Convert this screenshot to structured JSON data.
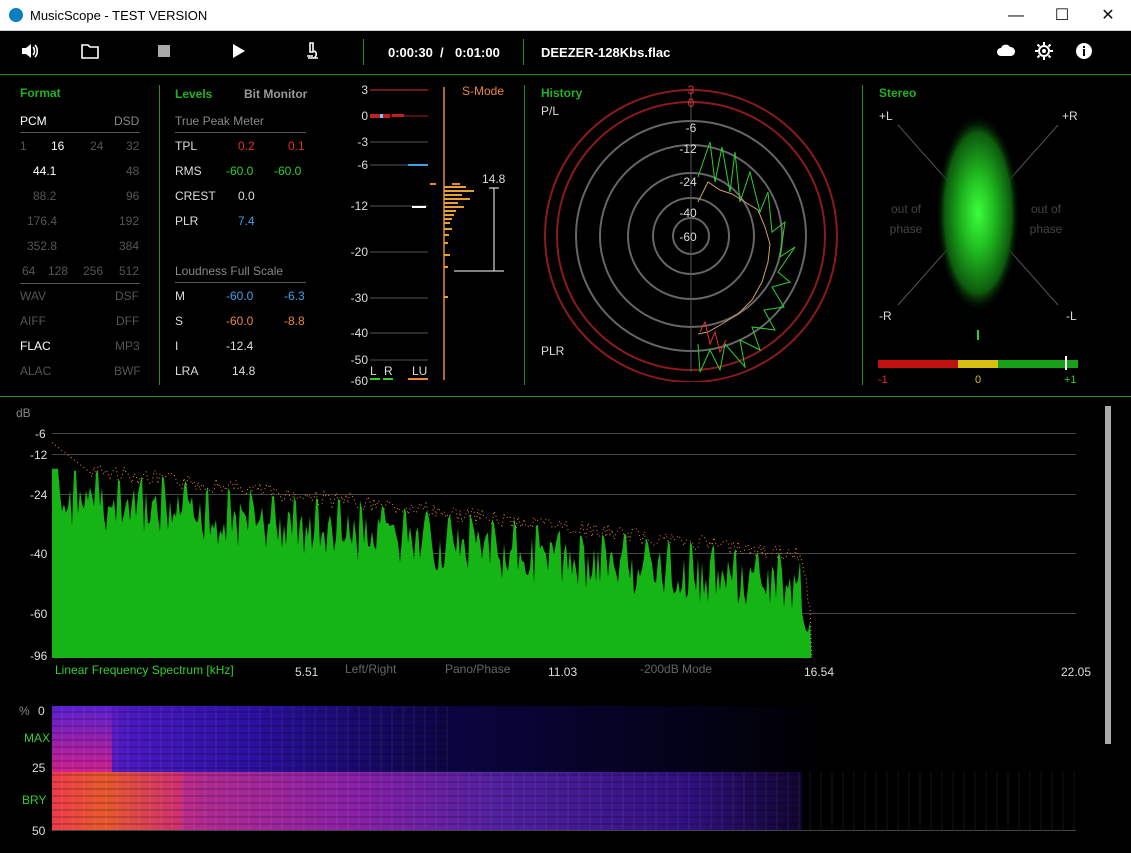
{
  "window": {
    "title": "MusicScope - TEST VERSION",
    "minimize": "—",
    "maximize": "☐",
    "close": "✕"
  },
  "toolbar": {
    "time_current": "0:00:30",
    "time_sep": "/",
    "time_total": "0:01:00",
    "filename": "DEEZER-128Kbs.flac",
    "icons": [
      "speaker-icon",
      "folder-icon",
      "stop-icon",
      "play-icon",
      "microscope-icon",
      "cloud-icon",
      "gear-icon",
      "info-icon"
    ]
  },
  "format": {
    "title": "Format",
    "pcm": "PCM",
    "dsd": "DSD",
    "bits": [
      "1",
      "16",
      "24",
      "32"
    ],
    "rates": [
      [
        "44.1",
        "48"
      ],
      [
        "88.2",
        "96"
      ],
      [
        "176.4",
        "192"
      ],
      [
        "352.8",
        "384"
      ]
    ],
    "dsd_rates": [
      "64",
      "128",
      "256",
      "512"
    ],
    "types": [
      [
        "WAV",
        "DSF"
      ],
      [
        "AIFF",
        "DFF"
      ],
      [
        "FLAC",
        "MP3"
      ],
      [
        "ALAC",
        "BWF"
      ]
    ]
  },
  "levels": {
    "title": "Levels",
    "bit_monitor": "Bit Monitor",
    "true_peak_title": "True Peak Meter",
    "tpl": {
      "label": "TPL",
      "l": "0.2",
      "r": "0.1"
    },
    "rms": {
      "label": "RMS",
      "l": "-60.0",
      "r": "-60.0"
    },
    "crest": {
      "label": "CREST",
      "v": "0.0"
    },
    "plr": {
      "label": "PLR",
      "v": "7.4"
    },
    "loudness_title": "Loudness Full Scale",
    "m": {
      "label": "M",
      "l": "-60.0",
      "r": "-6.3"
    },
    "s": {
      "label": "S",
      "l": "-60.0",
      "r": "-8.8"
    },
    "i": {
      "label": "I",
      "v": "-12.4"
    },
    "lra": {
      "label": "LRA",
      "v": "14.8"
    }
  },
  "meter": {
    "smode": "S-Mode",
    "ticks": [
      "3",
      "0",
      "-3",
      "-6",
      "-12",
      "-20",
      "-30",
      "-40",
      "-50",
      "-60"
    ],
    "lra_value": "14.8",
    "l": "L",
    "r": "R",
    "lu": "LU"
  },
  "history": {
    "title": "History",
    "pl": "P/L",
    "plr": "PLR",
    "rings": [
      "3",
      "0",
      "-6",
      "-12",
      "-24",
      "-40",
      "-60"
    ]
  },
  "stereo": {
    "title": "Stereo",
    "pl": "+L",
    "pr": "+R",
    "ml": "-L",
    "mr": "-R",
    "oop_left": "out of phase",
    "oop_right": "out of phase",
    "scale": [
      "-1",
      "0",
      "+1"
    ],
    "correlation": 0.87
  },
  "spectrum": {
    "db_label": "dB",
    "y_ticks": [
      "-6",
      "-12",
      "-24",
      "-40",
      "-60",
      "-96"
    ],
    "title": "Linear Frequency Spectrum [kHz]",
    "x_ticks": [
      "5.51",
      "11.03",
      "16.54",
      "22.05"
    ],
    "modes": [
      "Left/Right",
      "Pano/Phase",
      "-200dB Mode"
    ]
  },
  "spectrogram": {
    "pct": "%",
    "ticks": [
      "0",
      "25",
      "50"
    ],
    "max": "MAX",
    "bry": "BRY"
  },
  "colors": {
    "accent_green": "#22b222",
    "red": "#e03030",
    "blue": "#3fa0e8",
    "orange": "#e8893a"
  }
}
